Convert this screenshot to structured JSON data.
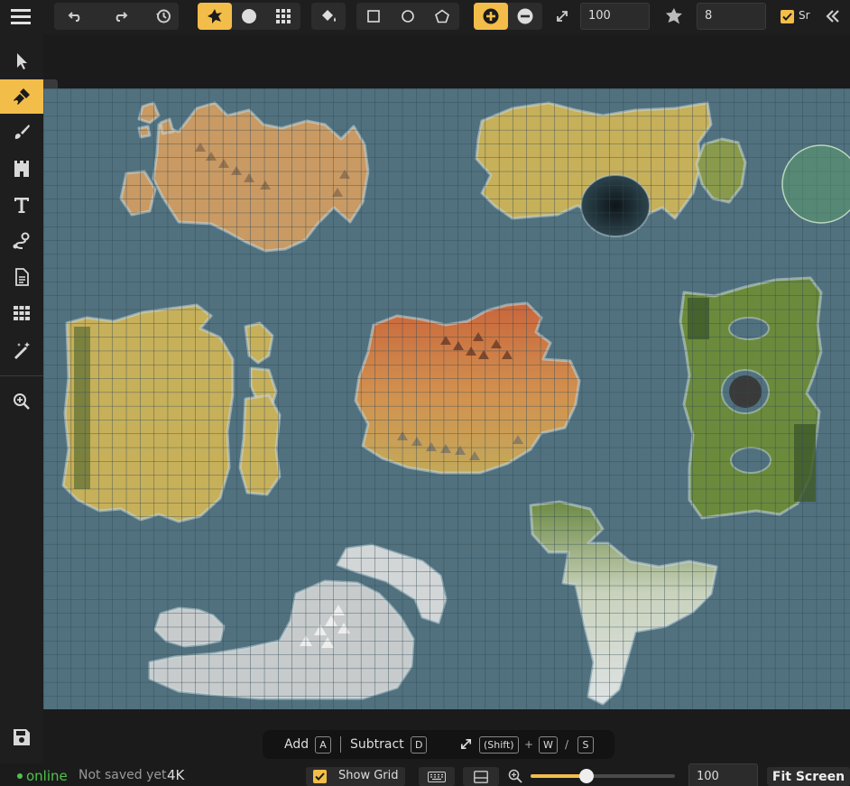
{
  "toolbar": {
    "size_value": "100",
    "points_value": "8",
    "snap_label": "Sr"
  },
  "hint_bar": {
    "add_label": "Add",
    "add_key": "A",
    "subtract_label": "Subtract",
    "subtract_key": "D",
    "shift_key": "(Shift)",
    "plus": "+",
    "w_key": "W",
    "slash": "/",
    "s_key": "S"
  },
  "status_bar": {
    "online_label": "online",
    "save_status": "Not saved yet",
    "resolution": "4K",
    "show_grid_label": "Show Grid",
    "zoom_value": "100",
    "fit_screen_label": "Fit Screen"
  },
  "colors": {
    "accent": "#f3bd4a",
    "ocean": "#51717f",
    "online": "#4ec24e"
  }
}
